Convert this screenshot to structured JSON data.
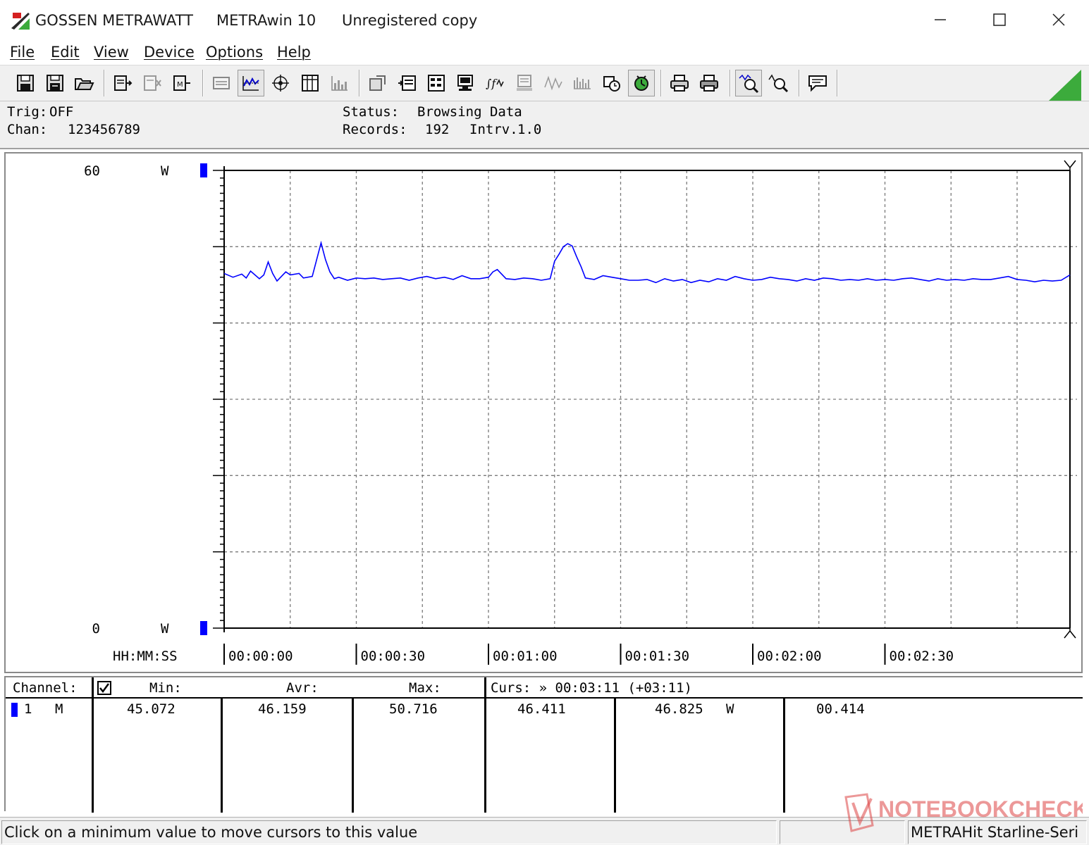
{
  "window": {
    "brand": "GOSSEN METRAWATT",
    "app": "METRAwin 10",
    "license": "Unregistered copy"
  },
  "menu": [
    "File",
    "Edit",
    "View",
    "Device",
    "Options",
    "Help"
  ],
  "toolbar_icons": [
    "save-icon",
    "save-as-icon",
    "open-folder-icon",
    "read-memory-icon",
    "clear-memory-icon",
    "online-measure-icon",
    "numeric-display-icon",
    "line-chart-icon",
    "xy-chart-icon",
    "table-view-icon",
    "bar-chart-icon",
    "add-marker-icon",
    "list-icon",
    "events-icon",
    "device-screen-icon",
    "formula-icon",
    "recorder-icon",
    "waveform-icon",
    "spectrum-icon",
    "timer-icon",
    "recording-icon",
    "print-icon",
    "print-preview-icon",
    "zoom-icon",
    "zoom-out-icon",
    "message-icon"
  ],
  "info": {
    "trig_label": "Trig:",
    "trig_value": "OFF",
    "chan_label": "Chan:",
    "chan_value": "123456789",
    "status_label": "Status:",
    "status_value": "Browsing Data",
    "records_label": "Records:",
    "records_value": "192",
    "intrv_label": "Intrv.",
    "intrv_value": "1.0"
  },
  "chart_data": {
    "type": "line",
    "ylabel": "W",
    "xlabel": "HH:MM:SS",
    "ylim": [
      0,
      60
    ],
    "y_tick_labels": [
      {
        "value": "60",
        "unit": "W"
      },
      {
        "value": "0",
        "unit": "W"
      }
    ],
    "xlim": [
      0,
      192
    ],
    "x_tick_labels": [
      "00:00:00",
      "00:00:30",
      "00:01:00",
      "00:01:30",
      "00:02:00",
      "00:02:30"
    ],
    "x_tick_values": [
      0,
      30,
      60,
      90,
      120,
      150
    ],
    "grid": true,
    "series": [
      {
        "color": "#0000ff",
        "x": [
          0,
          2,
          4,
          5,
          6,
          8,
          9,
          10,
          11,
          12,
          14,
          15,
          17,
          18,
          20,
          22,
          23,
          24,
          25,
          26,
          28,
          30,
          32,
          34,
          36,
          38,
          40,
          42,
          44,
          46,
          48,
          50,
          52,
          54,
          56,
          58,
          60,
          61,
          62,
          64,
          66,
          68,
          70,
          72,
          74,
          75,
          76,
          77,
          78,
          79,
          80,
          81,
          82,
          84,
          86,
          88,
          90,
          92,
          94,
          96,
          98,
          100,
          102,
          104,
          106,
          108,
          110,
          112,
          114,
          116,
          118,
          120,
          122,
          124,
          126,
          128,
          130,
          132,
          134,
          136,
          138,
          140,
          142,
          144,
          146,
          148,
          150,
          152,
          154,
          156,
          158,
          160,
          162,
          164,
          166,
          168,
          170,
          172,
          174,
          176,
          178,
          180,
          182,
          184,
          186,
          188,
          190,
          192
        ],
        "y": [
          46.5,
          46.0,
          46.4,
          45.9,
          46.8,
          45.8,
          46.3,
          48.0,
          46.5,
          45.5,
          46.7,
          46.3,
          46.5,
          45.9,
          46.1,
          50.5,
          48.3,
          46.7,
          45.8,
          46.0,
          45.6,
          45.9,
          45.8,
          45.9,
          45.7,
          45.8,
          45.9,
          45.6,
          45.9,
          46.1,
          45.8,
          46.0,
          45.7,
          46.2,
          45.8,
          45.8,
          46.0,
          46.7,
          47.0,
          45.8,
          45.7,
          45.9,
          45.8,
          45.6,
          45.8,
          48.1,
          49.0,
          50.0,
          50.4,
          50.1,
          48.7,
          47.4,
          45.9,
          45.7,
          46.2,
          46.0,
          45.8,
          45.6,
          45.6,
          45.7,
          45.3,
          45.8,
          45.5,
          45.7,
          45.3,
          45.6,
          45.4,
          45.8,
          45.6,
          46.1,
          45.8,
          45.6,
          45.7,
          46.0,
          45.8,
          45.7,
          45.5,
          45.8,
          45.6,
          45.9,
          45.8,
          45.6,
          45.7,
          45.6,
          45.8,
          45.6,
          45.7,
          45.6,
          45.8,
          45.9,
          45.7,
          45.5,
          45.8,
          45.6,
          45.7,
          45.6,
          45.8,
          45.7,
          45.7,
          45.9,
          46.1,
          45.7,
          45.6,
          45.4,
          45.6,
          45.5,
          45.6,
          46.3
        ]
      }
    ]
  },
  "stats": {
    "channel_label": "Channel:",
    "min_label": "Min:",
    "avr_label": "Avr:",
    "max_label": "Max:",
    "curs_label": "Curs: » 00:03:11 (+03:11)",
    "rows": [
      {
        "channel": "1",
        "mode": "M",
        "min": "45.072",
        "avr": "46.159",
        "max": "50.716",
        "cursor1": "46.411",
        "cursor2": "46.825",
        "unit": "W",
        "delta": "00.414"
      }
    ]
  },
  "statusbar": {
    "message": "Click on a minimum value to move cursors to this value",
    "device": "METRAHit Starline-Seri"
  },
  "watermark": "NOTEBOOKCHECK",
  "colors": {
    "trace": "#0000ff",
    "grid": "#7a7a7a",
    "marker": "#0000ff",
    "signal": "#3cab3c"
  }
}
